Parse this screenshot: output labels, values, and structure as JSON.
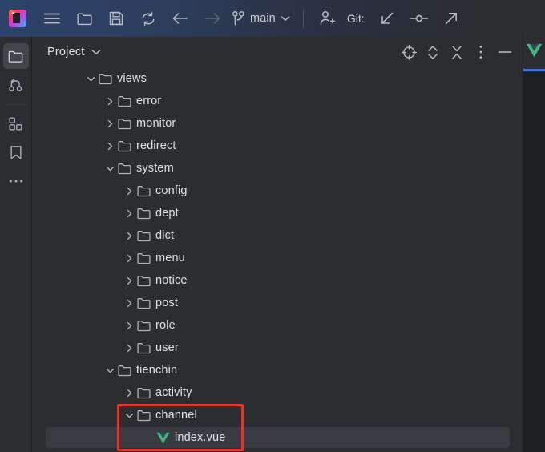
{
  "window": {
    "app": "intellij-idea",
    "accent_blue": "#3574f0",
    "selection_gray": "#393b40",
    "annotation_red": "#fc2b1c",
    "vue_green": "#41b883"
  },
  "toolbar": {
    "logo_name": "intellij-idea-logo",
    "main_menu_label": "Main Menu",
    "open_label": "Open",
    "save_label": "Save All",
    "sync_label": "Reload All from Disk",
    "back_label": "Back",
    "forward_label": "Forward",
    "branch_icon_label": "branch-icon",
    "branch_name": "main",
    "branch_chevron": "chevron-down-icon",
    "share_label": "Add Collaborator",
    "git_label": "Git:",
    "git_update_label": "Update Project",
    "git_commit_label": "Commit",
    "git_push_label": "Push"
  },
  "stripe": {
    "items": [
      {
        "name": "project-tool-button",
        "icon": "folder-icon",
        "active": true
      },
      {
        "name": "version-control-tool-button",
        "icon": "branch-icon",
        "active": false
      },
      {
        "name": "structure-tool-button",
        "icon": "structure-icon",
        "active": false
      },
      {
        "name": "bookmarks-tool-button",
        "icon": "bookmark-icon",
        "active": false
      },
      {
        "name": "more-tool-windows-button",
        "icon": "more-horizontal-icon",
        "active": false
      }
    ]
  },
  "tool_window": {
    "title": "Project",
    "title_chevron": "chevron-down-icon",
    "actions": [
      {
        "name": "select-opened-file-button",
        "icon": "target-icon"
      },
      {
        "name": "expand-collapse-button",
        "icon": "chevron-up-down-icon"
      },
      {
        "name": "collapse-all-button",
        "icon": "collapse-all-icon"
      },
      {
        "name": "options-menu-button",
        "icon": "more-vertical-icon"
      },
      {
        "name": "hide-button",
        "icon": "minimize-icon"
      }
    ]
  },
  "editor_tab": {
    "icon": "vue-file-icon",
    "selected": true
  },
  "tree": {
    "rows": [
      {
        "label": "views",
        "indent": 0,
        "state": "expanded",
        "icon": "folder-icon",
        "selected": false
      },
      {
        "label": "error",
        "indent": 1,
        "state": "collapsed",
        "icon": "folder-icon",
        "selected": false
      },
      {
        "label": "monitor",
        "indent": 1,
        "state": "collapsed",
        "icon": "folder-icon",
        "selected": false
      },
      {
        "label": "redirect",
        "indent": 1,
        "state": "collapsed",
        "icon": "folder-icon",
        "selected": false
      },
      {
        "label": "system",
        "indent": 1,
        "state": "expanded",
        "icon": "folder-icon",
        "selected": false
      },
      {
        "label": "config",
        "indent": 2,
        "state": "collapsed",
        "icon": "folder-icon",
        "selected": false
      },
      {
        "label": "dept",
        "indent": 2,
        "state": "collapsed",
        "icon": "folder-icon",
        "selected": false
      },
      {
        "label": "dict",
        "indent": 2,
        "state": "collapsed",
        "icon": "folder-icon",
        "selected": false
      },
      {
        "label": "menu",
        "indent": 2,
        "state": "collapsed",
        "icon": "folder-icon",
        "selected": false
      },
      {
        "label": "notice",
        "indent": 2,
        "state": "collapsed",
        "icon": "folder-icon",
        "selected": false
      },
      {
        "label": "post",
        "indent": 2,
        "state": "collapsed",
        "icon": "folder-icon",
        "selected": false
      },
      {
        "label": "role",
        "indent": 2,
        "state": "collapsed",
        "icon": "folder-icon",
        "selected": false
      },
      {
        "label": "user",
        "indent": 2,
        "state": "collapsed",
        "icon": "folder-icon",
        "selected": false
      },
      {
        "label": "tienchin",
        "indent": 1,
        "state": "expanded",
        "icon": "folder-icon",
        "selected": false
      },
      {
        "label": "activity",
        "indent": 2,
        "state": "collapsed",
        "icon": "folder-icon",
        "selected": false
      },
      {
        "label": "channel",
        "indent": 2,
        "state": "expanded",
        "icon": "folder-icon",
        "selected": false
      },
      {
        "label": "index.vue",
        "indent": 3,
        "state": "leaf",
        "icon": "vue-file-icon",
        "selected": true
      }
    ]
  },
  "annotation": {
    "name": "red-highlight-box",
    "targets": [
      "channel",
      "index.vue"
    ]
  },
  "scrollbar": {
    "name": "tree-vertical-scrollbar"
  }
}
